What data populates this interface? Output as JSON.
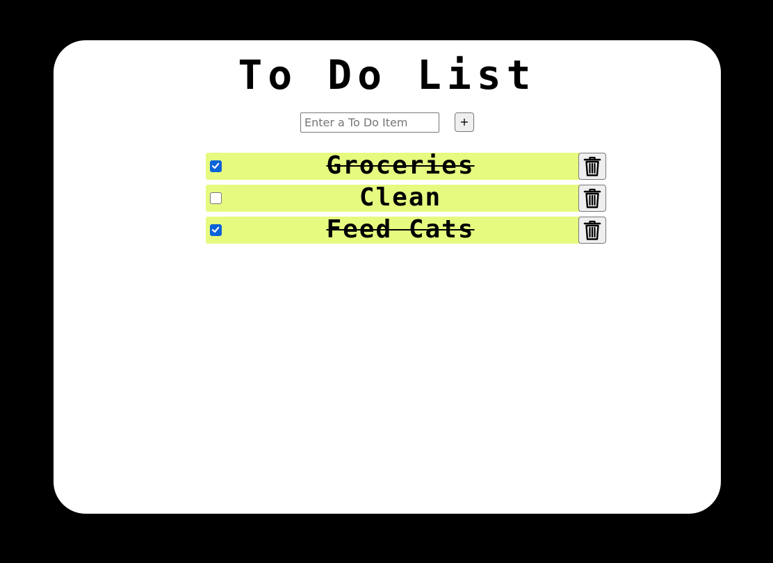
{
  "header": {
    "title": "To Do List"
  },
  "add_form": {
    "placeholder": "Enter a To Do Item",
    "value": "",
    "add_label": "+"
  },
  "todos": [
    {
      "label": "Groceries",
      "checked": true
    },
    {
      "label": "Clean",
      "checked": false
    },
    {
      "label": "Feed Cats",
      "checked": true
    }
  ],
  "icons": {
    "delete": "trash-icon",
    "check": "checkmark-icon"
  },
  "colors": {
    "page_background": "#000000",
    "card_background": "#ffffff",
    "item_background": "#e6fa80",
    "checkbox_checked": "#0b63d8"
  }
}
